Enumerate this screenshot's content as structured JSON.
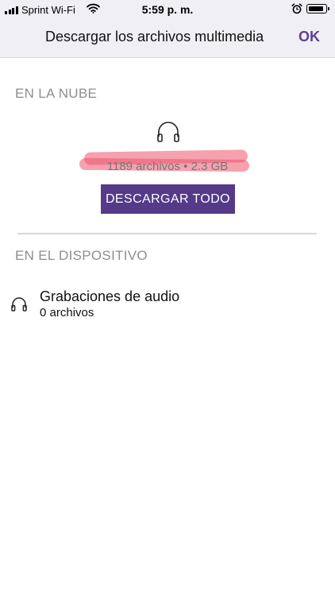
{
  "status_bar": {
    "carrier": "Sprint Wi-Fi",
    "time": "5:59 p. m.",
    "signal_bars": 4,
    "battery_level": 0.9,
    "icons": [
      "signal-icon",
      "wifi-icon",
      "alarm-icon",
      "battery-icon"
    ]
  },
  "nav": {
    "title": "Descargar los archivos multimedia",
    "ok_label": "OK"
  },
  "cloud": {
    "heading": "EN LA NUBE",
    "icon": "headphones-icon",
    "summary": "1189 archivos • 2.3 GB",
    "download_all_label": "DESCARGAR TODO"
  },
  "device": {
    "heading": "EN EL DISPOSITIVO",
    "items": [
      {
        "icon": "headphones-icon",
        "title": "Grabaciones de audio",
        "count": "0 archivos"
      }
    ]
  },
  "colors": {
    "accent": "#553a8a",
    "ok_text": "#5f3f91",
    "section_heading": "#8e8e93",
    "top_bar_bg": "#efeff4",
    "redaction": "#ec546c"
  }
}
